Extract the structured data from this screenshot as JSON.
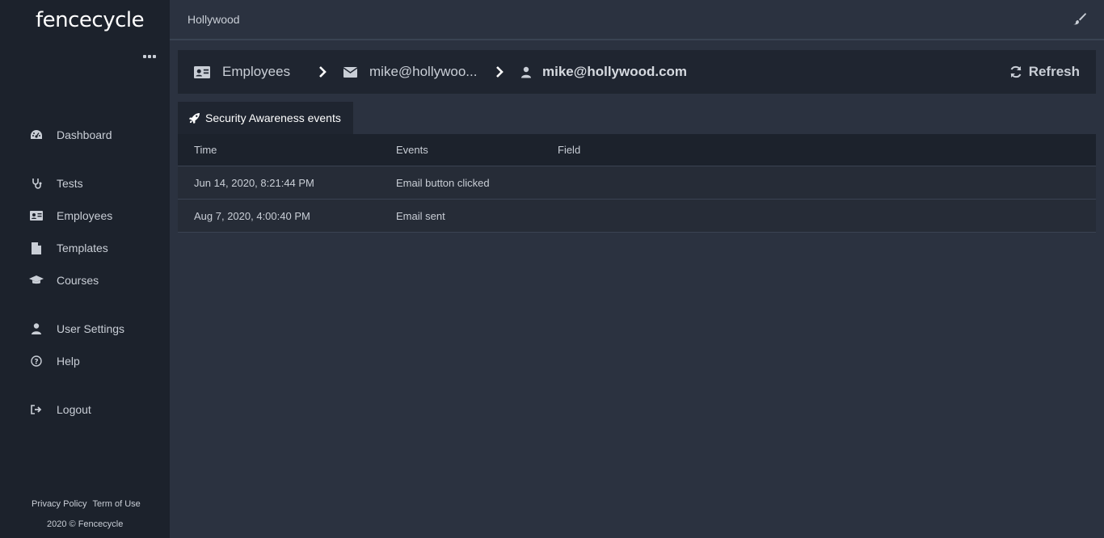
{
  "app": {
    "logo": "fencecycle"
  },
  "sidebar": {
    "items": [
      {
        "label": "Dashboard",
        "icon": "dashboard-icon"
      },
      {
        "label": "Tests",
        "icon": "stethoscope-icon"
      },
      {
        "label": "Employees",
        "icon": "id-card-icon"
      },
      {
        "label": "Templates",
        "icon": "file-icon"
      },
      {
        "label": "Courses",
        "icon": "graduation-cap-icon"
      },
      {
        "label": "User Settings",
        "icon": "user-icon"
      },
      {
        "label": "Help",
        "icon": "question-circle-icon"
      },
      {
        "label": "Logout",
        "icon": "sign-out-icon"
      }
    ],
    "footer": {
      "privacy": "Privacy Policy",
      "terms": "Term of Use",
      "copyright": "2020 © Fencecycle"
    }
  },
  "topbar": {
    "org": "Hollywood",
    "theme_icon": "paint-brush-icon"
  },
  "breadcrumb": {
    "employees": "Employees",
    "email_short": "mike@hollywoo...",
    "current": "mike@hollywood.com"
  },
  "refresh_label": "Refresh",
  "tab": {
    "label": "Security Awareness events",
    "icon": "rocket-icon"
  },
  "table": {
    "headers": [
      "Time",
      "Events",
      "Field"
    ],
    "rows": [
      {
        "time": "Jun 14, 2020, 8:21:44 PM",
        "event": "Email button clicked",
        "field": ""
      },
      {
        "time": "Aug 7, 2020, 4:00:40 PM",
        "event": "Email sent",
        "field": ""
      }
    ]
  },
  "colors": {
    "sidebar_bg": "#1c222c",
    "main_bg": "#2b3240",
    "panel_bg": "#1f2530",
    "text": "#c9ced6"
  }
}
